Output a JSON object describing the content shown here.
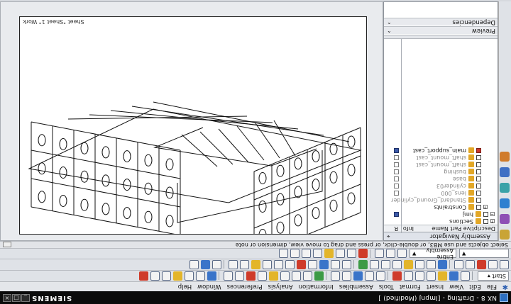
{
  "window": {
    "title": "NX 8 - Drafting - [lmpnj (Modified) ]",
    "brand": "SIEMENS",
    "controls": [
      "_",
      "□",
      "×"
    ]
  },
  "menu": {
    "items": [
      "File",
      "Edit",
      "View",
      "Insert",
      "Format",
      "Tools",
      "Assemblies",
      "Information",
      "Analysis",
      "Preferences",
      "Window",
      "Help"
    ]
  },
  "toolbar": {
    "start_label": "Start ▾",
    "assembly_combo": "Entire Assembly",
    "sheet_combo": "Sheet 1"
  },
  "status": {
    "prompt": "Select objects and use MB3, or double-click, or press and drag to move view, dimension or note"
  },
  "navigator": {
    "title": "Assembly Navigator",
    "columns": {
      "name": "Descriptive Part Name",
      "info": "Info",
      "r": "R"
    },
    "rows": [
      {
        "label": "Sections",
        "indent": 0,
        "expander": "+",
        "checked": false,
        "dim": false,
        "box": "none"
      },
      {
        "label": "hmj",
        "indent": 0,
        "expander": "-",
        "checked": false,
        "dim": false,
        "box": "blue"
      },
      {
        "label": "Constraints",
        "indent": 1,
        "expander": "+",
        "checked": false,
        "dim": false,
        "box": "none"
      },
      {
        "label": "Standard_Ground_cylinder",
        "indent": 1,
        "expander": "",
        "checked": false,
        "dim": true,
        "box": "none"
      },
      {
        "label": "lens_000",
        "indent": 1,
        "expander": "",
        "checked": false,
        "dim": true,
        "box": "white"
      },
      {
        "label": "cylinder03",
        "indent": 1,
        "expander": "",
        "checked": false,
        "dim": true,
        "box": "white"
      },
      {
        "label": "base",
        "indent": 1,
        "expander": "",
        "checked": false,
        "dim": true,
        "box": "white"
      },
      {
        "label": "bushing",
        "indent": 1,
        "expander": "",
        "checked": false,
        "dim": true,
        "box": "white"
      },
      {
        "label": "shaft_mount_cast",
        "indent": 1,
        "expander": "",
        "checked": false,
        "dim": true,
        "box": "white"
      },
      {
        "label": "shaft_mount_cast",
        "indent": 1,
        "expander": "",
        "checked": false,
        "dim": true,
        "box": "white"
      },
      {
        "label": "main_support_cast",
        "indent": 1,
        "expander": "",
        "checked": true,
        "dim": false,
        "box": "blue"
      }
    ],
    "preview_label": "Preview",
    "dependencies_label": "Dependencies"
  },
  "graphics": {
    "sheet_label": "Sheet \"Sheet 1\" Work"
  },
  "icons": {
    "resource_tabs": [
      "assembly-navigator-icon",
      "history-icon",
      "part-navigator-icon",
      "reuse-library-icon",
      "roles-icon",
      "web-browser-icon"
    ]
  },
  "colors": {
    "titlebar": "#0b0b0b",
    "accent": "#3a74c9",
    "check_red": "#c9372b"
  }
}
